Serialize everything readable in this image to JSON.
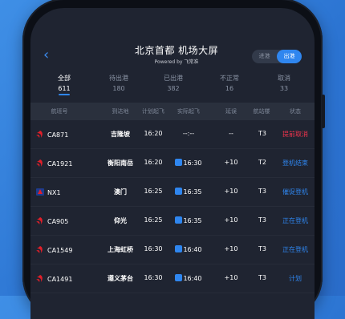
{
  "header": {
    "title": "北京首都 机场大屏",
    "subtitle": "Powered by 飞常准",
    "toggle_left": "进港",
    "toggle_right": "出港"
  },
  "tabs": [
    {
      "name": "全部",
      "count": "611"
    },
    {
      "name": "待出港",
      "count": "180"
    },
    {
      "name": "已出港",
      "count": "382"
    },
    {
      "name": "不正常",
      "count": "16"
    },
    {
      "name": "取消",
      "count": "33"
    }
  ],
  "columns": [
    "航班号",
    "到达地",
    "计划起飞",
    "实际起飞",
    "延误",
    "航站楼",
    "状态"
  ],
  "flights": [
    {
      "flight": "CA871",
      "dest": "吉隆坡",
      "plan": "16:20",
      "actual": "--:--",
      "delay": "--",
      "terminal": "T3",
      "status": "提前取消"
    },
    {
      "flight": "CA1921",
      "dest": "衡阳南岳",
      "plan": "16:20",
      "actual": "16:30",
      "delay": "+10",
      "terminal": "T2",
      "status": "登机结束"
    },
    {
      "flight": "NX1",
      "dest": "澳门",
      "plan": "16:25",
      "actual": "16:35",
      "delay": "+10",
      "terminal": "T3",
      "status": "催促登机"
    },
    {
      "flight": "CA905",
      "dest": "仰光",
      "plan": "16:25",
      "actual": "16:35",
      "delay": "+10",
      "terminal": "T3",
      "status": "正在登机"
    },
    {
      "flight": "CA1549",
      "dest": "上海虹桥",
      "plan": "16:30",
      "actual": "16:40",
      "delay": "+10",
      "terminal": "T3",
      "status": "正在登机"
    },
    {
      "flight": "CA1491",
      "dest": "遵义茅台",
      "plan": "16:30",
      "actual": "16:40",
      "delay": "+10",
      "terminal": "T3",
      "status": "计划"
    }
  ],
  "colors": {
    "accent": "#2f86ef",
    "danger": "#f0344d",
    "airchina": "#e21f2a",
    "airmacau": "#1d3c8f"
  }
}
